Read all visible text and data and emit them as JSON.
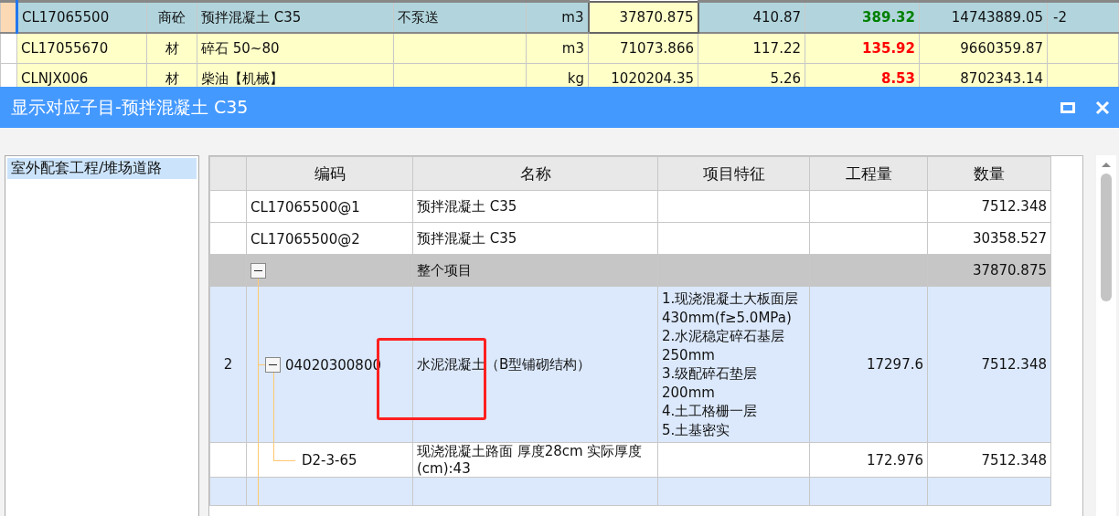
{
  "materials": {
    "rows": [
      {
        "selected": true,
        "code": "CL17065500",
        "type": "商砼",
        "name": "预拌混凝土 C35",
        "spec": "不泵送",
        "unit": "m3",
        "quantity": "37870.875",
        "price_1": "410.87",
        "price_2": "389.32",
        "color": "#008000",
        "total": "14743889.05",
        "column_11": "-2"
      },
      {
        "selected": false,
        "code": "CL17055670",
        "type": "材",
        "name": "碎石 50~80",
        "spec": "",
        "unit": "m3",
        "quantity": "71073.866",
        "price_1": "117.22",
        "price_2": "135.92",
        "color": "#ff0000",
        "total": "9660359.87"
      },
      {
        "selected": false,
        "code": "CLNJX006",
        "type": "材",
        "name": "柴油【机械】",
        "spec": "",
        "unit": "kg",
        "quantity": "1020204.35",
        "price_1": "5.26",
        "price_2": "8.53",
        "color": "#ff0000",
        "total": "8702343.14"
      }
    ]
  },
  "dialog": {
    "title": "显示对应子目-预拌混凝土 C35"
  },
  "sidebar": {
    "items": [
      {
        "label": "室外配套工程/堆场道路",
        "selected": true
      }
    ]
  },
  "detail": {
    "columns": [
      "编码",
      "名称",
      "项目特征",
      "工程量",
      "数量"
    ],
    "rows": [
      {
        "kind": "plain",
        "code": "CL17065500@1",
        "name": "预拌混凝土 C35",
        "quantity": "7512.348"
      },
      {
        "kind": "plain",
        "code": "CL17065500@2",
        "name": "预拌混凝土 C35",
        "quantity": "30358.527"
      },
      {
        "kind": "group",
        "expanded": true,
        "name": "整个项目",
        "quantity": "37870.875",
        "children": [
          {
            "kind": "item",
            "expanded": true,
            "number": "2",
            "code": "04020300800",
            "name": "水泥混凝土（B型铺砌结构）",
            "features": "1.现浇混凝土大板面层\n430mm(f≥5.0MPa)\n2.水泥稳定碎石基层250mm\n3.级配碎石垫层\n200mm\n4.土工格栅一层\n5.土基密实",
            "amount": "17297.6",
            "quantity": "7512.348",
            "children": [
              {
                "kind": "sub",
                "code": "D2-3-65",
                "name": "现浇混凝土路面 厚度28cm  实际厚度(cm):43",
                "amount": "172.976",
                "quantity": "7512.348"
              }
            ]
          }
        ]
      }
    ]
  }
}
